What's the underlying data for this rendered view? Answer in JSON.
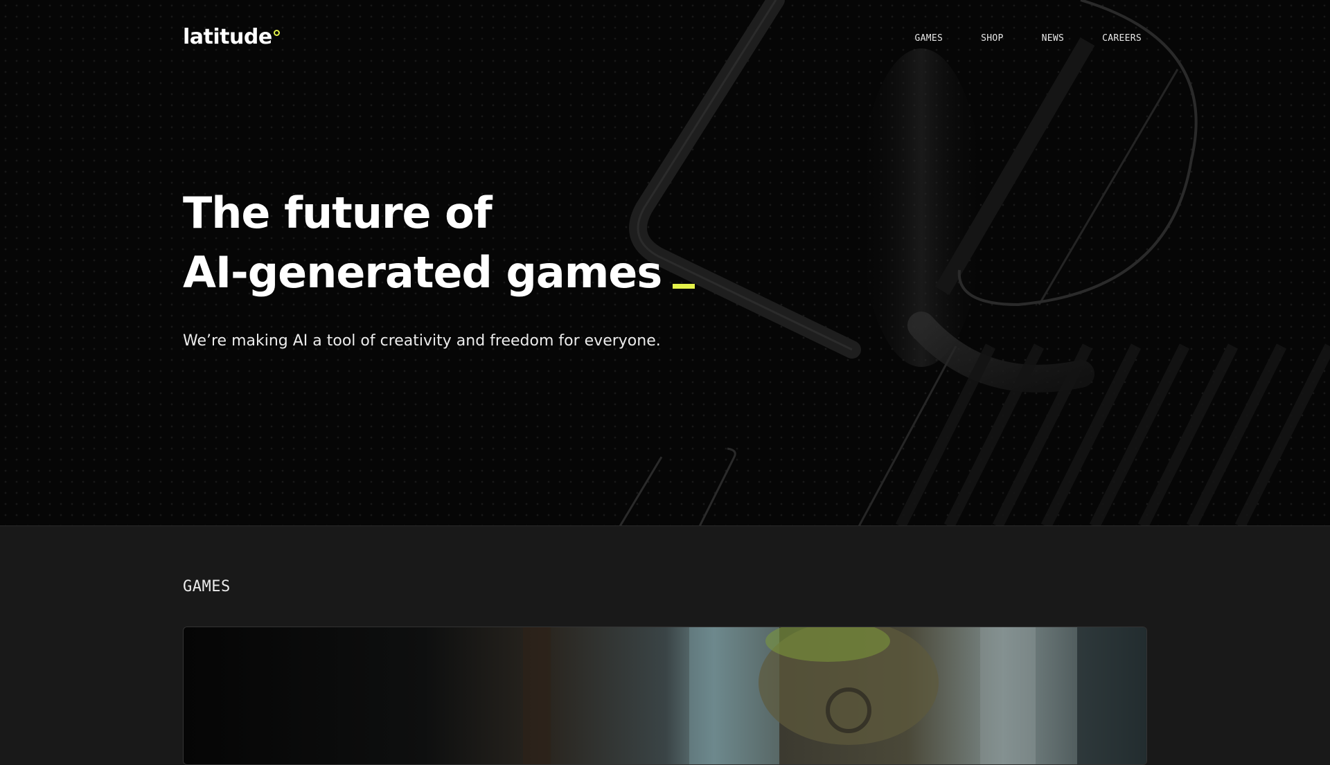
{
  "header": {
    "logo_text": "latitude",
    "logo_accent_color": "#e4f24a",
    "nav": [
      {
        "label": "GAMES"
      },
      {
        "label": "SHOP"
      },
      {
        "label": "NEWS"
      },
      {
        "label": "CAREERS"
      }
    ]
  },
  "hero": {
    "headline_line1": "The future of",
    "headline_line2": "AI-generated games",
    "subtitle": "We’re making AI a tool of creativity and freedom for everyone."
  },
  "games": {
    "section_title": "GAMES"
  },
  "colors": {
    "accent": "#e4f24a",
    "hero_background": "#060606",
    "section_background": "#191919"
  }
}
